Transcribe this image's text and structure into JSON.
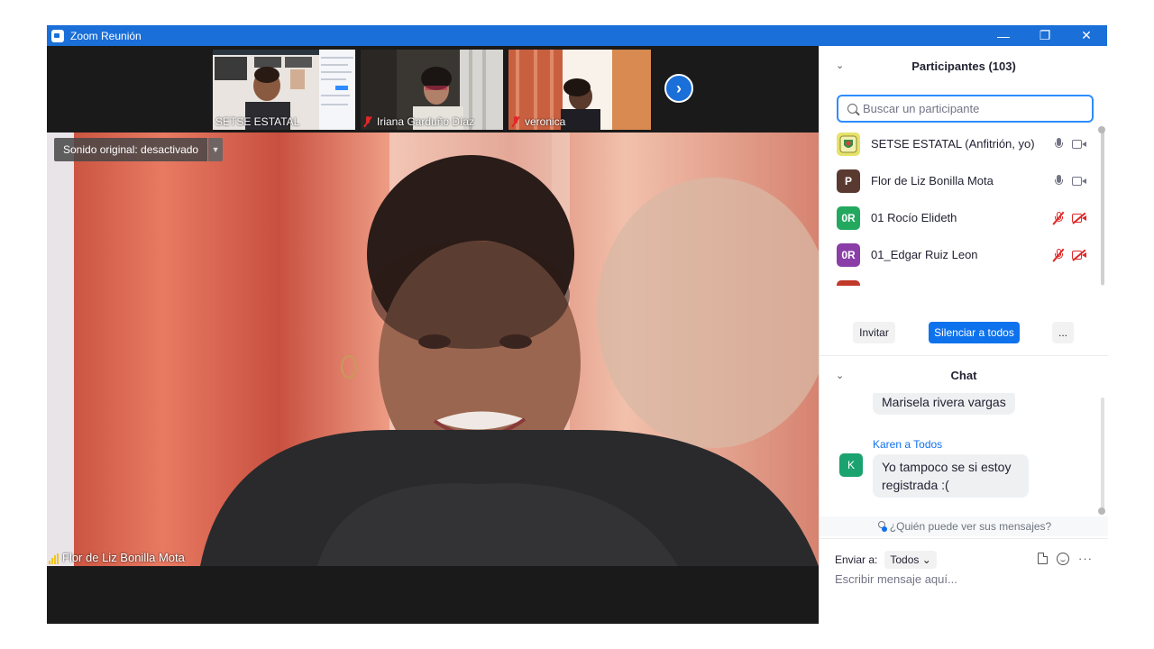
{
  "window": {
    "title": "Zoom Reunión",
    "accent": "#1a6fd8"
  },
  "thumbnails": [
    {
      "name": "SETSE ESTATAL",
      "muted": false
    },
    {
      "name": "Iriana Garduño Díaz",
      "muted": true
    },
    {
      "name": "veronica",
      "muted": true
    }
  ],
  "main_video": {
    "sound_label": "Sonido original: desactivado",
    "speaker_name": "Flor de Liz Bonilla Mota"
  },
  "participants": {
    "title": "Participantes (103)",
    "search_placeholder": "Buscar un participante",
    "list": [
      {
        "avatar": "",
        "avatar_color": "#d8d86a",
        "name": "SETSE ESTATAL (Anfitrión, yo)",
        "mic": "on",
        "video": "on"
      },
      {
        "avatar": "P",
        "avatar_color": "#5a3a30",
        "name": "Flor de Liz Bonilla Mota",
        "mic": "on",
        "video": "on"
      },
      {
        "avatar": "0R",
        "avatar_color": "#23a860",
        "name": "01 Rocío Elideth",
        "mic": "off",
        "video": "off"
      },
      {
        "avatar": "0R",
        "avatar_color": "#8a3ea8",
        "name": "01_Edgar Ruiz Leon",
        "mic": "off",
        "video": "off"
      }
    ],
    "invite_label": "Invitar",
    "mute_all_label": "Silenciar a todos",
    "more_label": "..."
  },
  "chat": {
    "title": "Chat",
    "messages": [
      {
        "text": "Marisela rivera vargas"
      },
      {
        "sender": "Karen a Todos",
        "avatar": "K",
        "text_line1": "Yo tampoco se si estoy",
        "text_line2": "registrada :("
      }
    ],
    "who_sees": "¿Quién puede ver sus mensajes?",
    "send_to_label": "Enviar a:",
    "send_to_value": "Todos",
    "input_placeholder": "Escribir mensaje aquí..."
  }
}
